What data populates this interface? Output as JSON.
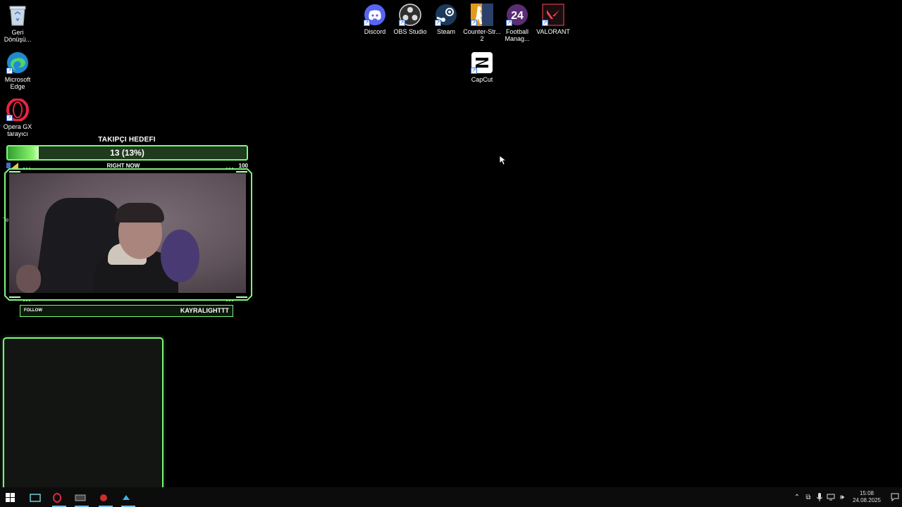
{
  "desktop_icons_left": [
    {
      "id": "recycle-bin",
      "label": "Geri\nDönüşü..."
    },
    {
      "id": "edge",
      "label": "Microsoft\nEdge"
    },
    {
      "id": "opera-gx",
      "label": "Opera GX\ntarayıcı"
    }
  ],
  "desktop_icons_top": [
    {
      "id": "discord",
      "label": "Discord"
    },
    {
      "id": "obs",
      "label": "OBS Studio"
    },
    {
      "id": "steam",
      "label": "Steam"
    },
    {
      "id": "cs2",
      "label": "Counter-Str...\n2"
    },
    {
      "id": "football-manager",
      "label": "Football\nManag..."
    },
    {
      "id": "valorant",
      "label": "VALORANT"
    },
    {
      "id": "capcut",
      "label": "CapCut"
    }
  ],
  "overlay": {
    "goal_title": "TAKIPÇI HEDEFI",
    "goal_value": "13 (13%)",
    "goal_progress": 0.13,
    "goal_sub_center": "RIGHT NOW",
    "goal_sub_right": "100",
    "follow_label": "FOLLOW",
    "follow_name": "KAYRALIGHTTT"
  },
  "edge_fragment": "Te",
  "taskbar": {
    "time": "15:08",
    "date": "24.08.2025"
  },
  "colors": {
    "accent_green": "#7cf77a",
    "taskbar_bg": "#0c0c0c"
  }
}
